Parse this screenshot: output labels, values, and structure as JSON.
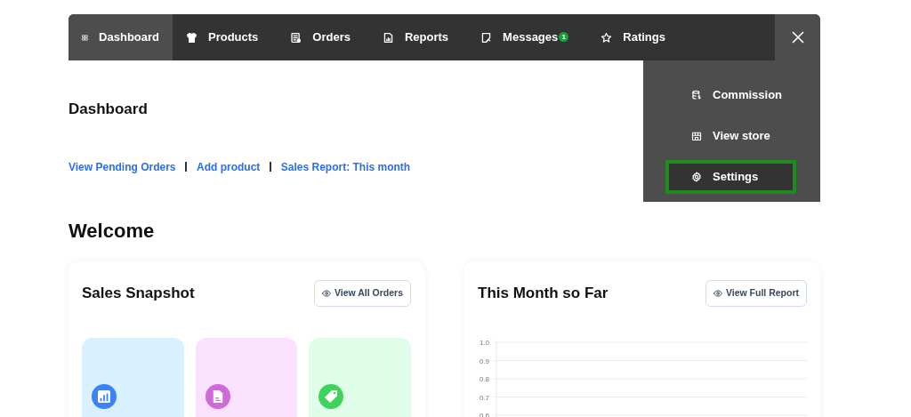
{
  "nav": {
    "items": [
      {
        "label": "Dashboard",
        "kind": "grid",
        "selected": true
      },
      {
        "label": "Products",
        "kind": "shirt",
        "selected": false
      },
      {
        "label": "Orders",
        "kind": "list",
        "selected": false
      },
      {
        "label": "Reports",
        "kind": "report",
        "selected": false
      },
      {
        "label": "Messages",
        "kind": "note",
        "selected": false,
        "badge": "1"
      },
      {
        "label": "Ratings",
        "kind": "star",
        "selected": false
      }
    ]
  },
  "menu": {
    "items": [
      {
        "label": "Commission",
        "kind": "coins",
        "selected": false
      },
      {
        "label": "View store",
        "kind": "store",
        "selected": false
      },
      {
        "label": "Settings",
        "kind": "gear",
        "selected": true
      }
    ]
  },
  "page_title": "Dashboard",
  "quick_links": [
    "View Pending Orders",
    "Add product",
    "Sales Report: This month"
  ],
  "welcome": "Welcome",
  "sales_snapshot": {
    "title": "Sales Snapshot",
    "button": "View All Orders",
    "tiles": [
      {
        "kind": "chart",
        "color": "#3b82f6"
      },
      {
        "kind": "doc",
        "color": "#d06ad8"
      },
      {
        "kind": "tag",
        "color": "#3ed35a"
      }
    ]
  },
  "month_card": {
    "title": "This Month so Far",
    "button": "View Full Report",
    "axis_labels": [
      "1.0",
      "0.9",
      "0.8",
      "0.7",
      "0.6"
    ]
  }
}
